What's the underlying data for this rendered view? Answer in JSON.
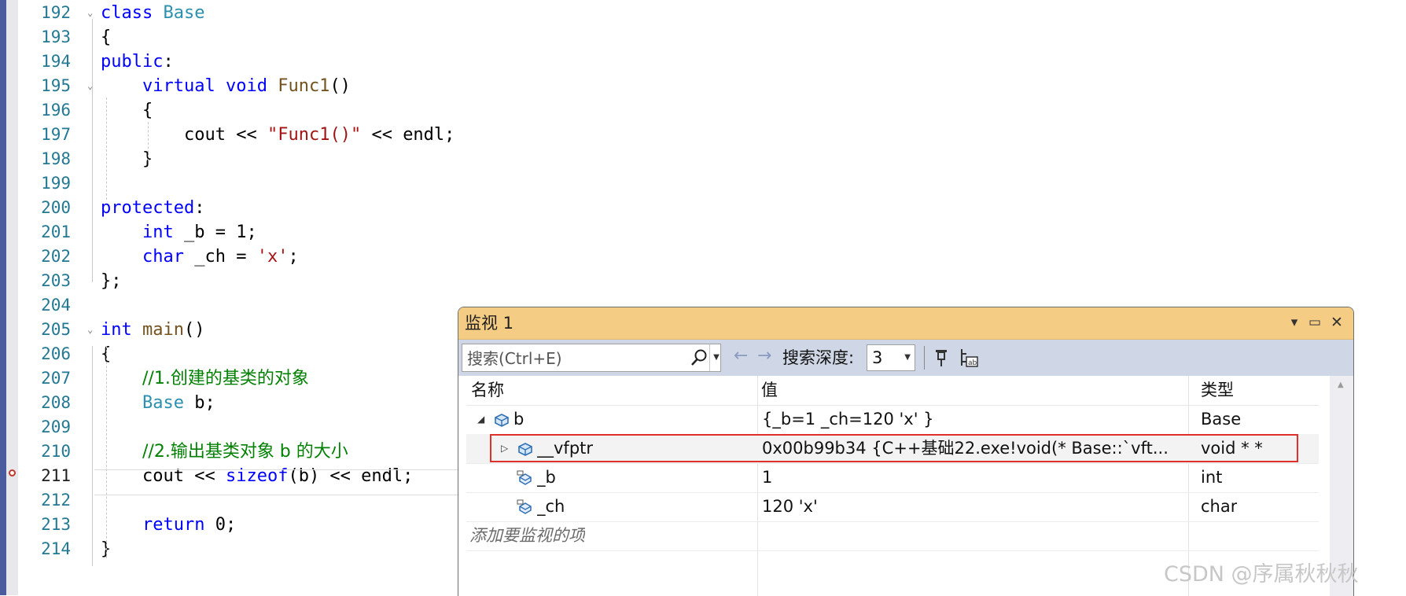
{
  "editor": {
    "lines": [
      {
        "no": "192",
        "fold": "⌄",
        "indent": 0,
        "tokens": [
          [
            "kw",
            "class"
          ],
          [
            "punc",
            " "
          ],
          [
            "ty",
            "Base"
          ]
        ]
      },
      {
        "no": "193",
        "fold": "",
        "indent": 0,
        "tokens": [
          [
            "punc",
            "{"
          ]
        ]
      },
      {
        "no": "194",
        "fold": "",
        "indent": 0,
        "tokens": [
          [
            "kw",
            "public"
          ],
          [
            "punc",
            ":"
          ]
        ]
      },
      {
        "no": "195",
        "fold": "⌄",
        "indent": 1,
        "tokens": [
          [
            "kw",
            "virtual"
          ],
          [
            "punc",
            " "
          ],
          [
            "kw",
            "void"
          ],
          [
            "punc",
            " "
          ],
          [
            "fn",
            "Func1"
          ],
          [
            "punc",
            "()"
          ]
        ]
      },
      {
        "no": "196",
        "fold": "",
        "indent": 1,
        "tokens": [
          [
            "punc",
            "{"
          ]
        ]
      },
      {
        "no": "197",
        "fold": "",
        "indent": 2,
        "tokens": [
          [
            "punc",
            "cout "
          ],
          [
            "punc",
            "<< "
          ],
          [
            "str",
            "\"Func1()\""
          ],
          [
            "punc",
            " << "
          ],
          [
            "punc",
            "endl;"
          ]
        ]
      },
      {
        "no": "198",
        "fold": "",
        "indent": 1,
        "tokens": [
          [
            "punc",
            "}"
          ]
        ]
      },
      {
        "no": "199",
        "fold": "",
        "indent": 0,
        "tokens": []
      },
      {
        "no": "200",
        "fold": "",
        "indent": 0,
        "tokens": [
          [
            "kw",
            "protected"
          ],
          [
            "punc",
            ":"
          ]
        ]
      },
      {
        "no": "201",
        "fold": "",
        "indent": 1,
        "tokens": [
          [
            "kw",
            "int"
          ],
          [
            "punc",
            " _b = 1;"
          ]
        ]
      },
      {
        "no": "202",
        "fold": "",
        "indent": 1,
        "tokens": [
          [
            "kw",
            "char"
          ],
          [
            "punc",
            " _ch = "
          ],
          [
            "str",
            "'x'"
          ],
          [
            "punc",
            ";"
          ]
        ]
      },
      {
        "no": "203",
        "fold": "",
        "indent": 0,
        "tokens": [
          [
            "punc",
            "};"
          ]
        ]
      },
      {
        "no": "204",
        "fold": "",
        "indent": 0,
        "tokens": []
      },
      {
        "no": "205",
        "fold": "⌄",
        "indent": 0,
        "tokens": [
          [
            "kw",
            "int"
          ],
          [
            "punc",
            " "
          ],
          [
            "fn",
            "main"
          ],
          [
            "punc",
            "()"
          ]
        ]
      },
      {
        "no": "206",
        "fold": "",
        "indent": 0,
        "tokens": [
          [
            "punc",
            "{"
          ]
        ]
      },
      {
        "no": "207",
        "fold": "",
        "indent": 1,
        "tokens": [
          [
            "cm",
            "//1.创建的基类的对象"
          ]
        ]
      },
      {
        "no": "208",
        "fold": "",
        "indent": 1,
        "tokens": [
          [
            "ty",
            "Base"
          ],
          [
            "punc",
            " b;"
          ]
        ]
      },
      {
        "no": "209",
        "fold": "",
        "indent": 0,
        "tokens": []
      },
      {
        "no": "210",
        "fold": "",
        "indent": 1,
        "tokens": [
          [
            "cm",
            "//2.输出基类对象 b 的大小"
          ]
        ]
      },
      {
        "no": "211",
        "fold": "",
        "indent": 1,
        "tokens": [
          [
            "punc",
            "cout << "
          ],
          [
            "kw",
            "sizeof"
          ],
          [
            "punc",
            "(b) << endl;"
          ]
        ]
      },
      {
        "no": "212",
        "fold": "",
        "indent": 0,
        "tokens": []
      },
      {
        "no": "213",
        "fold": "",
        "indent": 1,
        "tokens": [
          [
            "kw",
            "return"
          ],
          [
            "punc",
            " 0;"
          ]
        ]
      },
      {
        "no": "214",
        "fold": "",
        "indent": 0,
        "tokens": [
          [
            "punc",
            "}"
          ]
        ]
      }
    ]
  },
  "watch": {
    "title": "监视 1",
    "search_placeholder": "搜索(Ctrl+E)",
    "depth_label": "搜索深度:",
    "depth_value": "3",
    "columns": {
      "name": "名称",
      "value": "值",
      "type": "类型"
    },
    "rows": [
      {
        "name": "b",
        "value": "{_b=1 _ch=120 'x' }",
        "type": "Base",
        "expander": "◢",
        "icon": "object-icon",
        "level": 0
      },
      {
        "name": "__vfptr",
        "value": "0x00b99b34 {C++基础22.exe!void(* Base::`vft...",
        "type": "void * *",
        "expander": "▷",
        "icon": "object-icon",
        "level": 1
      },
      {
        "name": "_b",
        "value": "1",
        "type": "int",
        "expander": "",
        "icon": "field-icon",
        "level": 1
      },
      {
        "name": "_ch",
        "value": "120 'x'",
        "type": "char",
        "expander": "",
        "icon": "field-icon",
        "level": 1
      }
    ],
    "add_watch_text": "添加要监视的项"
  },
  "watermark": "CSDN @序属秋秋秋",
  "colors": {
    "title_bar": "#f5cc84",
    "toolbar": "#cfd6e5",
    "highlight": "#e0302c",
    "keyword": "#0000ff",
    "type": "#2b91af",
    "comment": "#008000",
    "string": "#a31515"
  }
}
